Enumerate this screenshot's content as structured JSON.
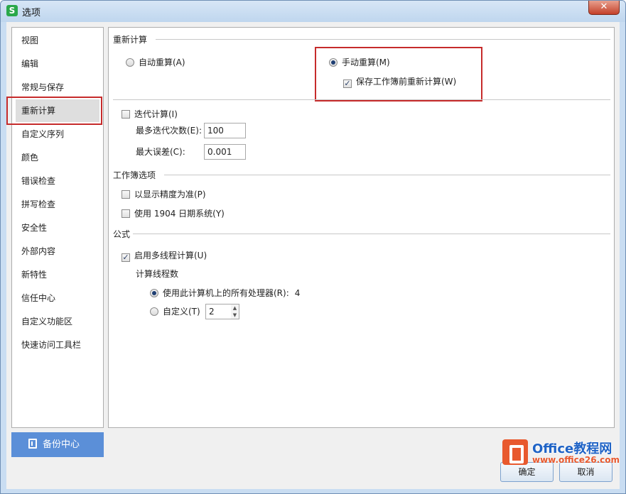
{
  "window": {
    "title": "选项",
    "close_label": "✕",
    "app_icon_letter": "S"
  },
  "sidebar": {
    "items": [
      {
        "label": "视图"
      },
      {
        "label": "编辑"
      },
      {
        "label": "常规与保存"
      },
      {
        "label": "重新计算"
      },
      {
        "label": "自定义序列"
      },
      {
        "label": "颜色"
      },
      {
        "label": "错误检查"
      },
      {
        "label": "拼写检查"
      },
      {
        "label": "安全性"
      },
      {
        "label": "外部内容"
      },
      {
        "label": "新特性"
      },
      {
        "label": "信任中心"
      },
      {
        "label": "自定义功能区"
      },
      {
        "label": "快速访问工具栏"
      }
    ],
    "active_index": 3,
    "backup_label": "备份中心"
  },
  "recalc": {
    "section_title": "重新计算",
    "auto_label": "自动重算(A)",
    "manual_label": "手动重算(M)",
    "save_recalc_label": "保存工作簿前重新计算(W)",
    "auto_selected": false,
    "manual_selected": true,
    "save_recalc_checked": true
  },
  "iteration": {
    "enable_label": "迭代计算(I)",
    "enabled": false,
    "max_iter_label": "最多迭代次数(E):",
    "max_iter_value": "100",
    "max_change_label": "最大误差(C):",
    "max_change_value": "0.001"
  },
  "workbook": {
    "section_title": "工作簿选项",
    "precision_label": "以显示精度为准(P)",
    "precision_checked": false,
    "date1904_label": "使用 1904 日期系统(Y)",
    "date1904_checked": false
  },
  "formula": {
    "section_title": "公式",
    "multithread_label": "启用多线程计算(U)",
    "multithread_checked": true,
    "threads_label": "计算线程数",
    "all_processors_label": "使用此计算机上的所有处理器(R):",
    "processor_count": "4",
    "all_processors_selected": true,
    "custom_label": "自定义(T)",
    "custom_selected": false,
    "custom_value": "2"
  },
  "footer": {
    "ok_label": "确定",
    "cancel_label": "取消"
  },
  "watermark": {
    "brand": "Office教程网",
    "url": "www.office26.com"
  },
  "colors": {
    "highlight": "#c62b2b",
    "backup_button": "#5b8fd8",
    "radio_dot": "#1f3f73"
  }
}
